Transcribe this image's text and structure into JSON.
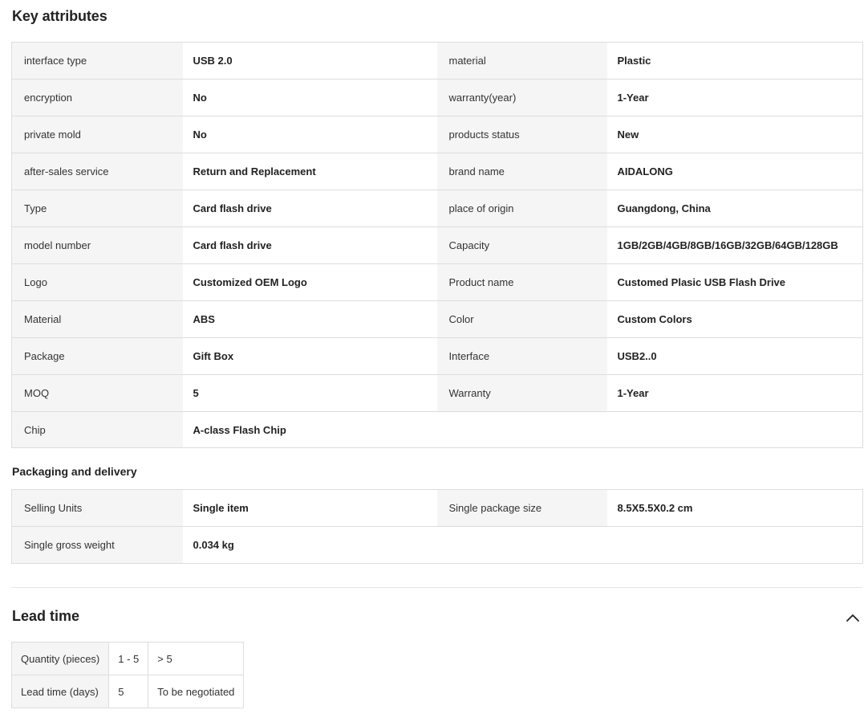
{
  "key_attributes": {
    "title": "Key attributes",
    "rows": [
      [
        {
          "k": "interface type",
          "v": "USB 2.0"
        },
        {
          "k": "material",
          "v": "Plastic"
        }
      ],
      [
        {
          "k": "encryption",
          "v": "No"
        },
        {
          "k": "warranty(year)",
          "v": "1-Year"
        }
      ],
      [
        {
          "k": "private mold",
          "v": "No"
        },
        {
          "k": "products status",
          "v": "New"
        }
      ],
      [
        {
          "k": "after-sales service",
          "v": "Return and Replacement"
        },
        {
          "k": "brand name",
          "v": "AIDALONG"
        }
      ],
      [
        {
          "k": "Type",
          "v": "Card flash drive"
        },
        {
          "k": "place of origin",
          "v": "Guangdong, China"
        }
      ],
      [
        {
          "k": "model number",
          "v": "Card flash drive"
        },
        {
          "k": "Capacity",
          "v": "1GB/2GB/4GB/8GB/16GB/32GB/64GB/128GB"
        }
      ],
      [
        {
          "k": "Logo",
          "v": "Customized OEM Logo"
        },
        {
          "k": "Product name",
          "v": "Customed Plasic USB Flash Drive"
        }
      ],
      [
        {
          "k": "Material",
          "v": "ABS"
        },
        {
          "k": "Color",
          "v": "Custom Colors"
        }
      ],
      [
        {
          "k": "Package",
          "v": "Gift Box"
        },
        {
          "k": "Interface",
          "v": "USB2..0"
        }
      ],
      [
        {
          "k": "MOQ",
          "v": "5"
        },
        {
          "k": "Warranty",
          "v": "1-Year"
        }
      ],
      [
        {
          "k": "Chip",
          "v": "A-class Flash Chip"
        }
      ]
    ]
  },
  "packaging": {
    "title": "Packaging and delivery",
    "rows": [
      [
        {
          "k": "Selling Units",
          "v": "Single item"
        },
        {
          "k": "Single package size",
          "v": "8.5X5.5X0.2 cm"
        }
      ],
      [
        {
          "k": "Single gross weight",
          "v": "0.034 kg"
        }
      ]
    ]
  },
  "lead_time": {
    "title": "Lead time",
    "toggle_icon": "chevron-up-icon",
    "quantity_label": "Quantity (pieces)",
    "days_label": "Lead time (days)",
    "quantities": [
      "1 - 5",
      "> 5"
    ],
    "days": [
      "5",
      "To be negotiated"
    ]
  }
}
